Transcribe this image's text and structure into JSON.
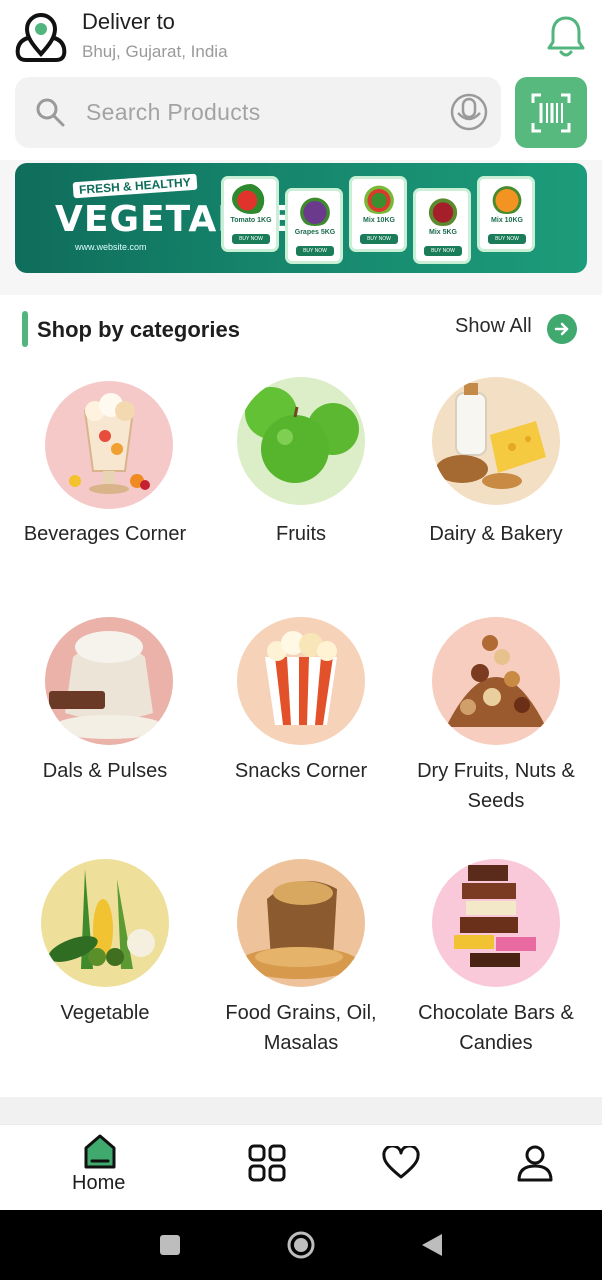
{
  "header": {
    "deliver_title": "Deliver to",
    "location": "Bhuj, Gujarat, India"
  },
  "search": {
    "placeholder": "Search Products"
  },
  "banner": {
    "tag": "FRESH & HEALTHY",
    "title": "VEGETABLE",
    "website": "www.website.com",
    "cards": [
      {
        "label": "Tomato 1KG",
        "button": "BUY NOW"
      },
      {
        "label": "Grapes 5KG",
        "button": "BUY NOW"
      },
      {
        "label": "Mix 10KG",
        "button": "BUY NOW"
      },
      {
        "label": "Mix 5KG",
        "button": "BUY NOW"
      },
      {
        "label": "Mix 10KG",
        "button": "BUY NOW"
      }
    ]
  },
  "categories": {
    "title": "Shop by categories",
    "show_all": "Show All",
    "items": [
      {
        "label": "Beverages Corner",
        "bg": "#f6c9c9"
      },
      {
        "label": "Fruits",
        "bg": "#dbeec7"
      },
      {
        "label": "Dairy & Bakery",
        "bg": "#f3dfc3"
      },
      {
        "label": "Dals & Pulses",
        "bg": "#eab2a9"
      },
      {
        "label": "Snacks Corner",
        "bg": "#f6d2b9"
      },
      {
        "label": "Dry Fruits, Nuts & Seeds",
        "bg": "#f6cdbf"
      },
      {
        "label": "Vegetable",
        "bg": "#eee09b"
      },
      {
        "label": "Food Grains, Oil, Masalas",
        "bg": "#eec39c"
      },
      {
        "label": "Chocolate Bars & Candies",
        "bg": "#f9c9d9"
      }
    ]
  },
  "nav": {
    "home_label": "Home"
  },
  "colors": {
    "accent": "#57b97d",
    "banner": "#16856c"
  }
}
